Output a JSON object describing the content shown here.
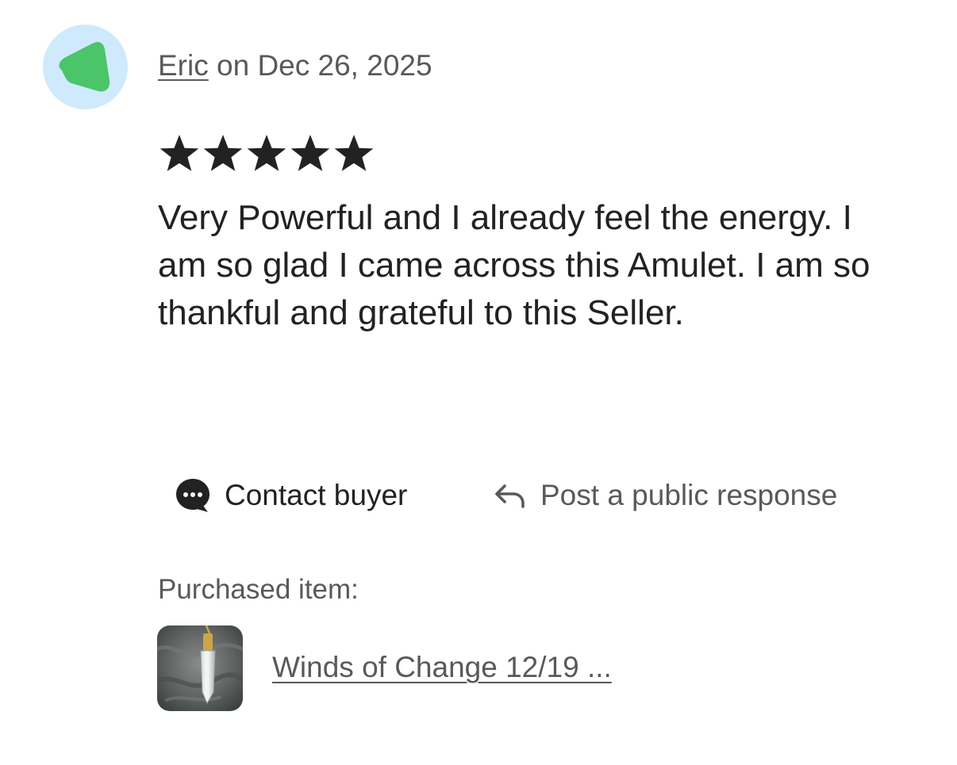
{
  "review": {
    "author": "Eric",
    "date_text": " on Dec 26, 2025",
    "rating": 5,
    "rating_max": 5,
    "text": "Very Powerful and I already feel the energy. I am so glad I came across this Amulet. I am so thankful and grateful to this Seller."
  },
  "avatar": {
    "icon": "green-rounded-triangle",
    "background_color": "#cfeafc",
    "shape_color": "#4bc46a"
  },
  "actions": {
    "contact_buyer": {
      "label": "Contact buyer",
      "icon": "chat-bubble-dots-icon"
    },
    "public_response": {
      "label": "Post a public response",
      "icon": "reply-arrow-icon"
    }
  },
  "purchase": {
    "label": "Purchased item:",
    "item_title": "Winds of Change 12/19 ...",
    "thumbnail": "crystal-pendant-photo"
  },
  "colors": {
    "primary_text": "#222222",
    "secondary_text": "#595959",
    "star": "#222222"
  }
}
